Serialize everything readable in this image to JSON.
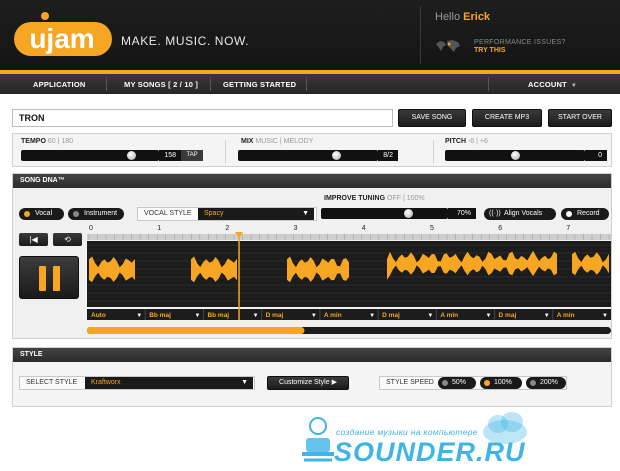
{
  "header": {
    "logo_text": "ujam",
    "tagline": "MAKE. MUSIC. NOW.",
    "greeting": "Hello",
    "user_name": "Erick",
    "perf_notice": "PERFORMANCE ISSUES?",
    "perf_link": "TRY THIS"
  },
  "nav": {
    "items": [
      "APPLICATION",
      "MY SONGS [ 2 / 10 ]",
      "GETTING STARTED"
    ],
    "account": "ACCOUNT"
  },
  "song": {
    "title": "TRON",
    "save_label": "SAVE SONG",
    "mp3_label": "CREATE MP3",
    "start_over_label": "START OVER"
  },
  "controls": {
    "tempo": {
      "label": "TEMPO",
      "range": "60 | 180",
      "value": "158",
      "tap": "TAP",
      "level": 0.82
    },
    "mix": {
      "label": "MIX",
      "range": "MUSIC | MELODY",
      "value": "8/2",
      "level": 0.72
    },
    "pitch": {
      "label": "PITCH",
      "range": "-6 | +6",
      "value": "0",
      "level": 0.5
    }
  },
  "dna": {
    "title": "SONG DNA™",
    "vocal": "Vocal",
    "instrument": "Instrument",
    "vocal_style_label": "VOCAL STYLE",
    "vocal_style_value": "Spacy",
    "improve_tuning_label": "IMPROVE TUNING",
    "improve_tuning_range": "OFF | 100%",
    "tuning_value": "70%",
    "tuning_level": 0.7,
    "align_vocals": "Align Vocals",
    "record": "Record",
    "rewind_icon": "skip-back-icon",
    "loop_icon": "loop-icon",
    "pause_icon": "pause-icon",
    "timeline": [
      "0",
      "1",
      "2",
      "3",
      "4",
      "5",
      "6",
      "7"
    ],
    "playhead_position": 2.2,
    "progress": 0.415,
    "chords": [
      "Auto",
      "Bb maj",
      "Bb maj",
      "D maj",
      "A min",
      "D maj",
      "A min",
      "D maj",
      "A min"
    ],
    "accent_color": "#f6a623"
  },
  "style": {
    "title": "STYLE",
    "select_label": "SELECT STYLE",
    "select_value": "Kraftworx",
    "customize": "Customize Style",
    "speed_label": "STYLE SPEED",
    "speeds": [
      "50%",
      "100%",
      "200%"
    ],
    "selected_speed": 1
  },
  "watermark": {
    "tagline": "создание музыки на компьютере",
    "brand": "SOUNDER.RU",
    "color": "#3fb4e6"
  }
}
